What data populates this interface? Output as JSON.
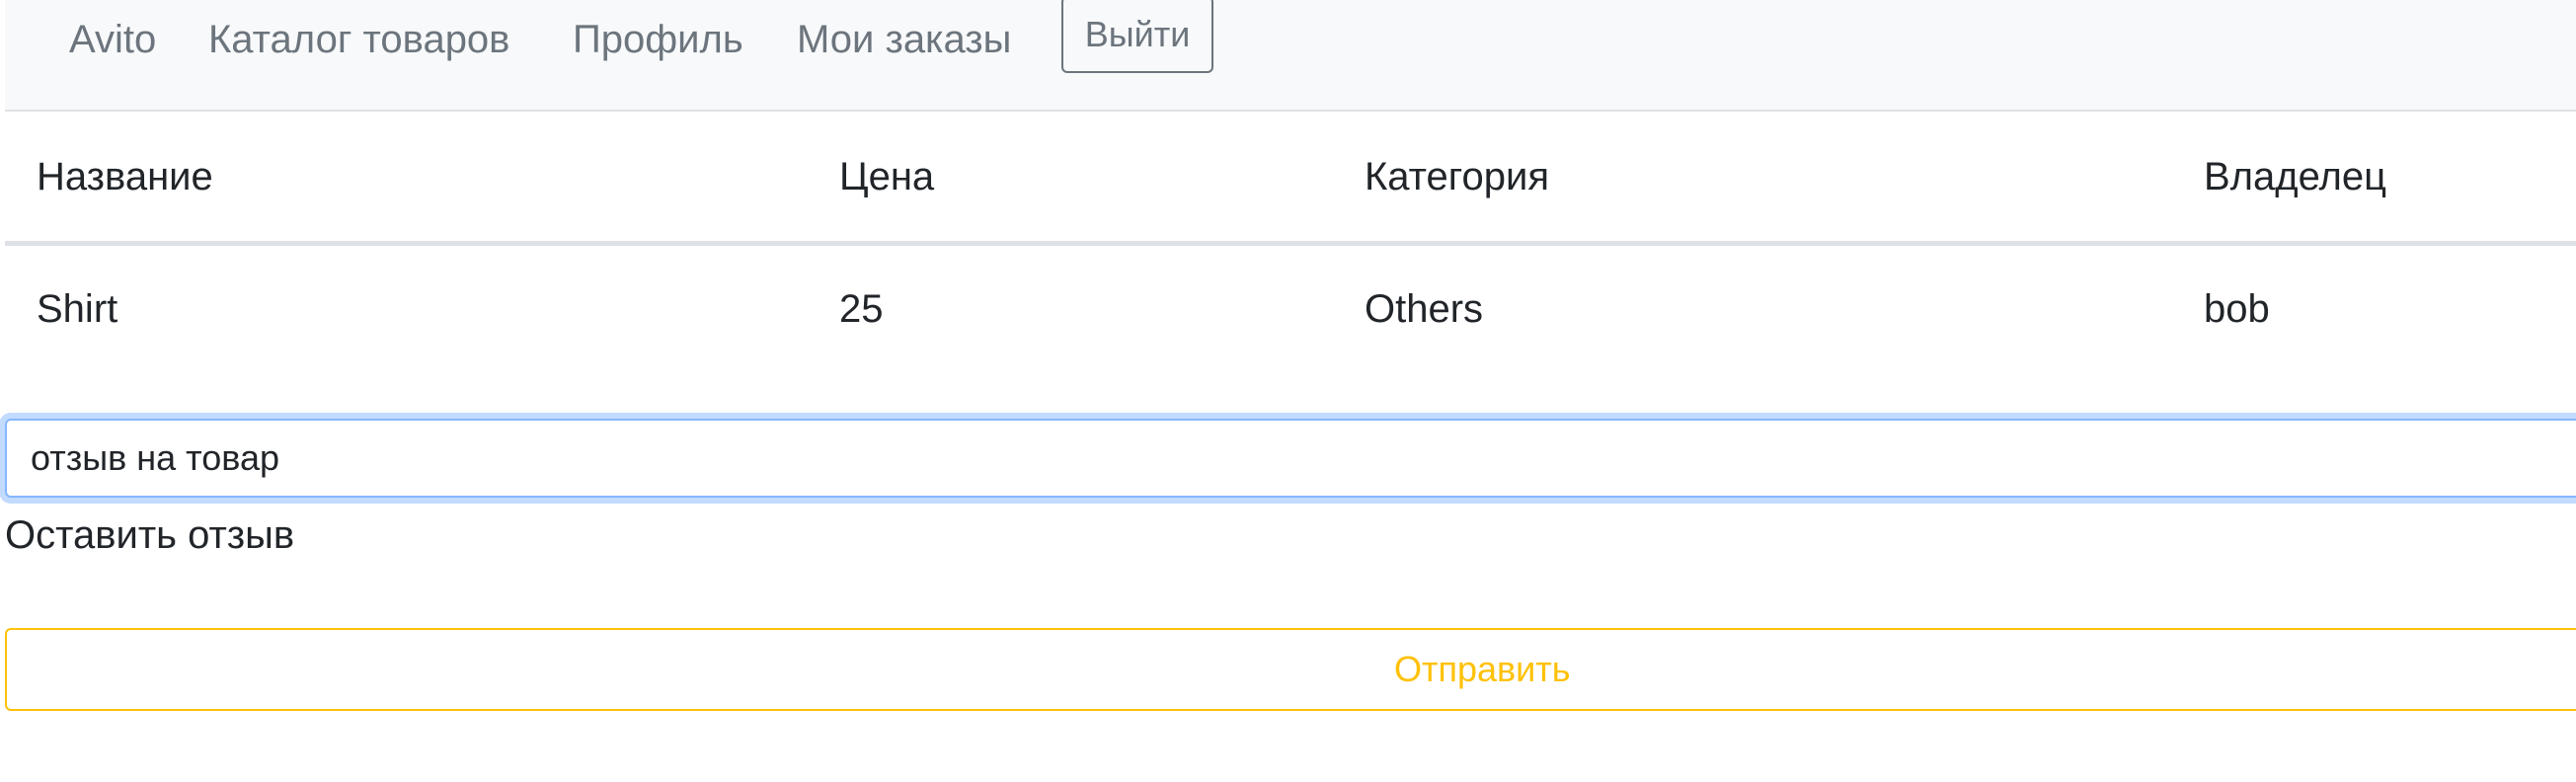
{
  "navbar": {
    "brand": "Avito",
    "links": {
      "catalog": "Каталог товаров",
      "profile": "Профиль",
      "orders": "Мои заказы"
    },
    "logout_label": "Выйти"
  },
  "table": {
    "headers": [
      "Название",
      "Цена",
      "Категория",
      "Владелец"
    ],
    "rows": [
      [
        "Shirt",
        "25",
        "Others",
        "bob"
      ]
    ]
  },
  "review": {
    "input_value": "отзыв на товар",
    "label": "Оставить отзыв",
    "submit_label": "Отправить"
  },
  "colors": {
    "navbar_bg": "#f8f9fa",
    "nav_link": "#6c757d",
    "focus_border": "#86b7fe",
    "warning": "#ffc107"
  }
}
